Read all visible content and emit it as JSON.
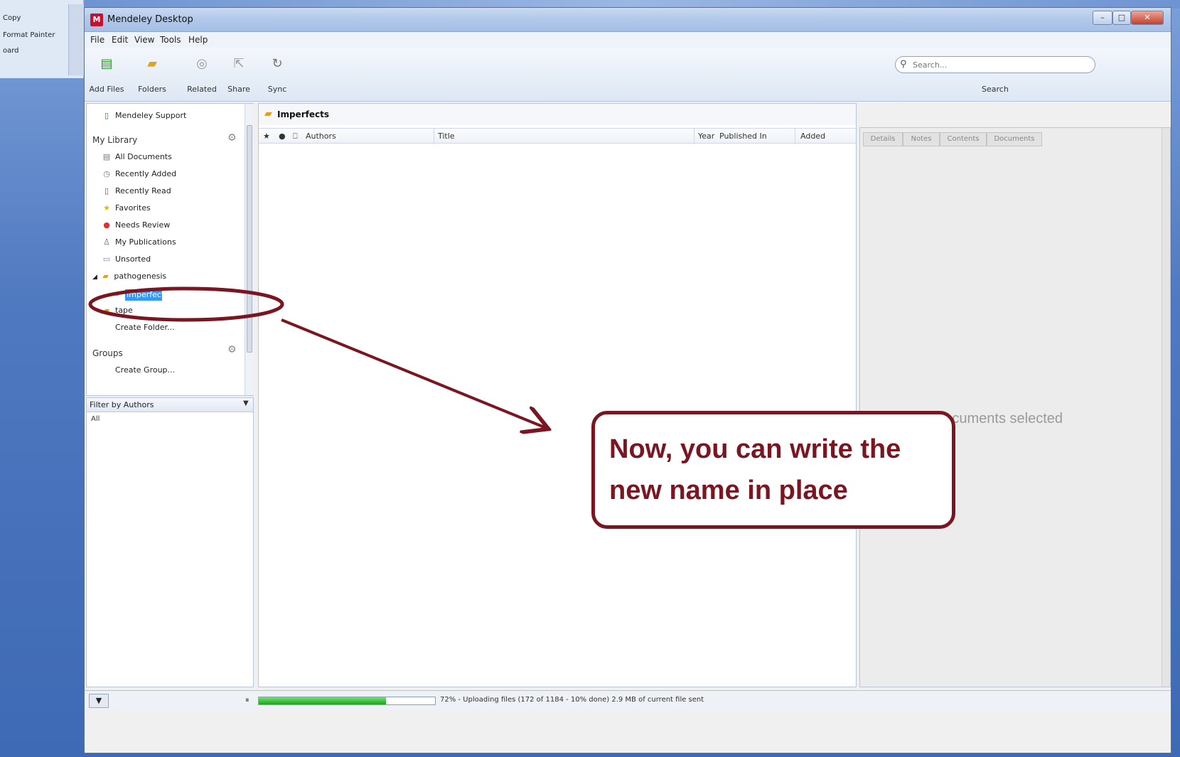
{
  "word": {
    "items": [
      "Copy",
      "Format Painter",
      "oard"
    ]
  },
  "window": {
    "title": "Mendeley Desktop",
    "logo": "M",
    "controls": {
      "minimize": "–",
      "maximize": "□",
      "close": "✕"
    }
  },
  "menu": [
    "File",
    "Edit",
    "View",
    "Tools",
    "Help"
  ],
  "toolbar": {
    "buttons": [
      {
        "label": "Add Files",
        "icon": "add-files-icon"
      },
      {
        "label": "Folders",
        "icon": "folders-icon"
      },
      {
        "label": "Related",
        "icon": "related-icon"
      },
      {
        "label": "Share",
        "icon": "share-icon"
      },
      {
        "label": "Sync",
        "icon": "sync-icon"
      }
    ],
    "search_placeholder": "Search...",
    "search_label": "Search"
  },
  "sidebar": {
    "support": "Mendeley Support",
    "library_header": "My Library",
    "library_items": [
      {
        "label": "All Documents",
        "icon": "documents-icon"
      },
      {
        "label": "Recently Added",
        "icon": "clock-icon"
      },
      {
        "label": "Recently Read",
        "icon": "book-icon"
      },
      {
        "label": "Favorites",
        "icon": "star-icon"
      },
      {
        "label": "Needs Review",
        "icon": "review-icon"
      },
      {
        "label": "My Publications",
        "icon": "person-icon"
      },
      {
        "label": "Unsorted",
        "icon": "inbox-icon"
      }
    ],
    "parent_folder": "pathogenesis",
    "editing_folder": "Imperfects",
    "sub_folder": "tape",
    "create_folder": "Create Folder...",
    "groups_header": "Groups",
    "create_group": "Create Group..."
  },
  "filter": {
    "label": "Filter by Authors",
    "first": "All"
  },
  "center": {
    "folder_title": "Imperfects",
    "columns": [
      "Authors",
      "Title",
      "Year",
      "Published In",
      "Added"
    ]
  },
  "right_panel": {
    "tabs": [
      "Details",
      "Notes",
      "Contents",
      "Documents"
    ],
    "empty_text": "No documents selected"
  },
  "status": {
    "progress_percent": 72,
    "text": "72% - Uploading files (172 of 1184 - 10% done) 2.9 MB of current file sent"
  },
  "annotation": {
    "callout_text": "Now, you can write the new name in place",
    "color": "#7a1621"
  }
}
